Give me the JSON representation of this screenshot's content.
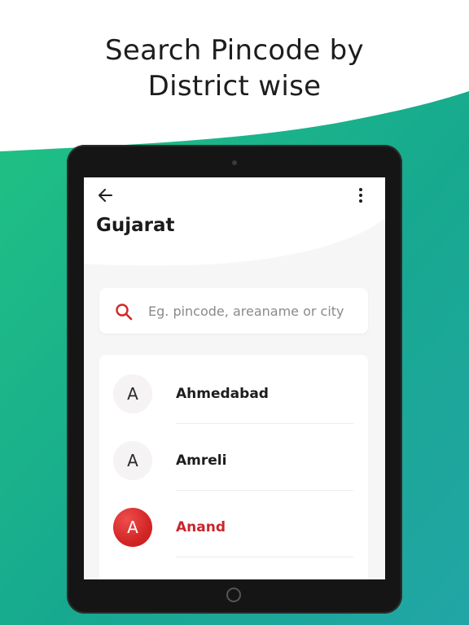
{
  "promo": {
    "headline_line1": "Search Pincode by",
    "headline_line2": "District wise"
  },
  "colors": {
    "wave_gradient_start": "#1fbf84",
    "wave_gradient_end": "#1aa6a0",
    "accent_red": "#d32626",
    "active_text": "#c8262d"
  },
  "app": {
    "title": "Gujarat",
    "back_icon": "arrow-left-icon",
    "menu_icon": "more-vertical-icon"
  },
  "search": {
    "icon": "search-icon",
    "placeholder": "Eg. pincode, areaname or city",
    "value": ""
  },
  "districts": [
    {
      "initial": "A",
      "name": "Ahmedabad",
      "active": false
    },
    {
      "initial": "A",
      "name": "Amreli",
      "active": false
    },
    {
      "initial": "A",
      "name": "Anand",
      "active": true
    }
  ]
}
